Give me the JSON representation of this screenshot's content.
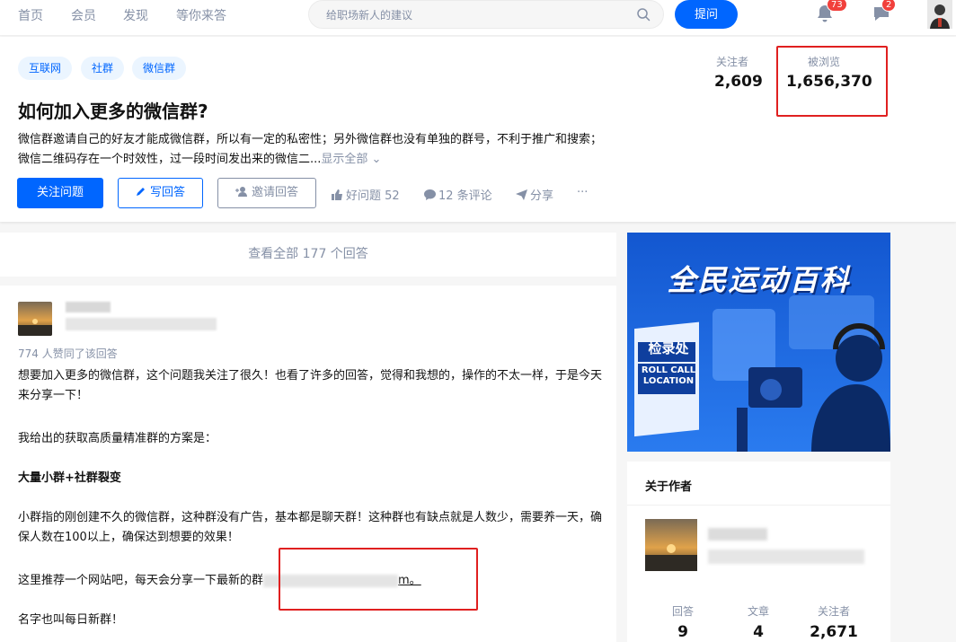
{
  "nav": {
    "links": [
      "首页",
      "会员",
      "发现",
      "等你来答"
    ],
    "search_placeholder": "给职场新人的建议",
    "ask_label": "提问",
    "notification_count": "73",
    "message_count": "2"
  },
  "question": {
    "tags": [
      "互联网",
      "社群",
      "微信群"
    ],
    "title": "如何加入更多的微信群?",
    "description": "微信群邀请自己的好友才能成微信群，所以有一定的私密性；另外微信群也没有单独的群号，不利于推广和搜索；微信二维码存在一个时效性，过一段时间发出来的微信二...",
    "show_all": "显示全部 ⌄",
    "follow_button": "关注问题",
    "write_button": "写回答",
    "invite_button": "邀请回答",
    "good_question": "好问题 52",
    "comments": "12 条评论",
    "share": "分享",
    "more": "···",
    "followers_label": "关注者",
    "followers_value": "2,609",
    "views_label": "被浏览",
    "views_value": "1,656,370"
  },
  "answers": {
    "view_all": "查看全部 177 个回答",
    "upvote_text": "774 人赞同了该回答",
    "paragraphs": [
      "想要加入更多的微信群，这个问题我关注了很久！也看了许多的回答，觉得和我想的，操作的不太一样，于是今天来分享一下！",
      "我给出的获取高质量精准群的方案是：",
      "大量小群+社群裂变",
      "小群指的刚创建不久的微信群，这种群没有广告，基本都是聊天群！这种群也有缺点就是人数少，需要养一天，确保人数在100以上，确保达到想要的效果！",
      "这里推荐一个网站吧，每天会分享一下最新的群",
      "名字也叫每日新群！"
    ],
    "link_suffix": "m。"
  },
  "sidebar": {
    "banner_text": "全民运动百科",
    "banner_sign_cn": "检录处",
    "banner_sign_en1": "ROLL CALL",
    "banner_sign_en2": "LOCATION",
    "author_title": "关于作者",
    "stats": [
      {
        "label": "回答",
        "value": "9"
      },
      {
        "label": "文章",
        "value": "4"
      },
      {
        "label": "关注者",
        "value": "2,671"
      }
    ]
  },
  "colors": {
    "brand": "#0066ff",
    "highlight_box": "#e02020",
    "badge": "#f1403c"
  }
}
